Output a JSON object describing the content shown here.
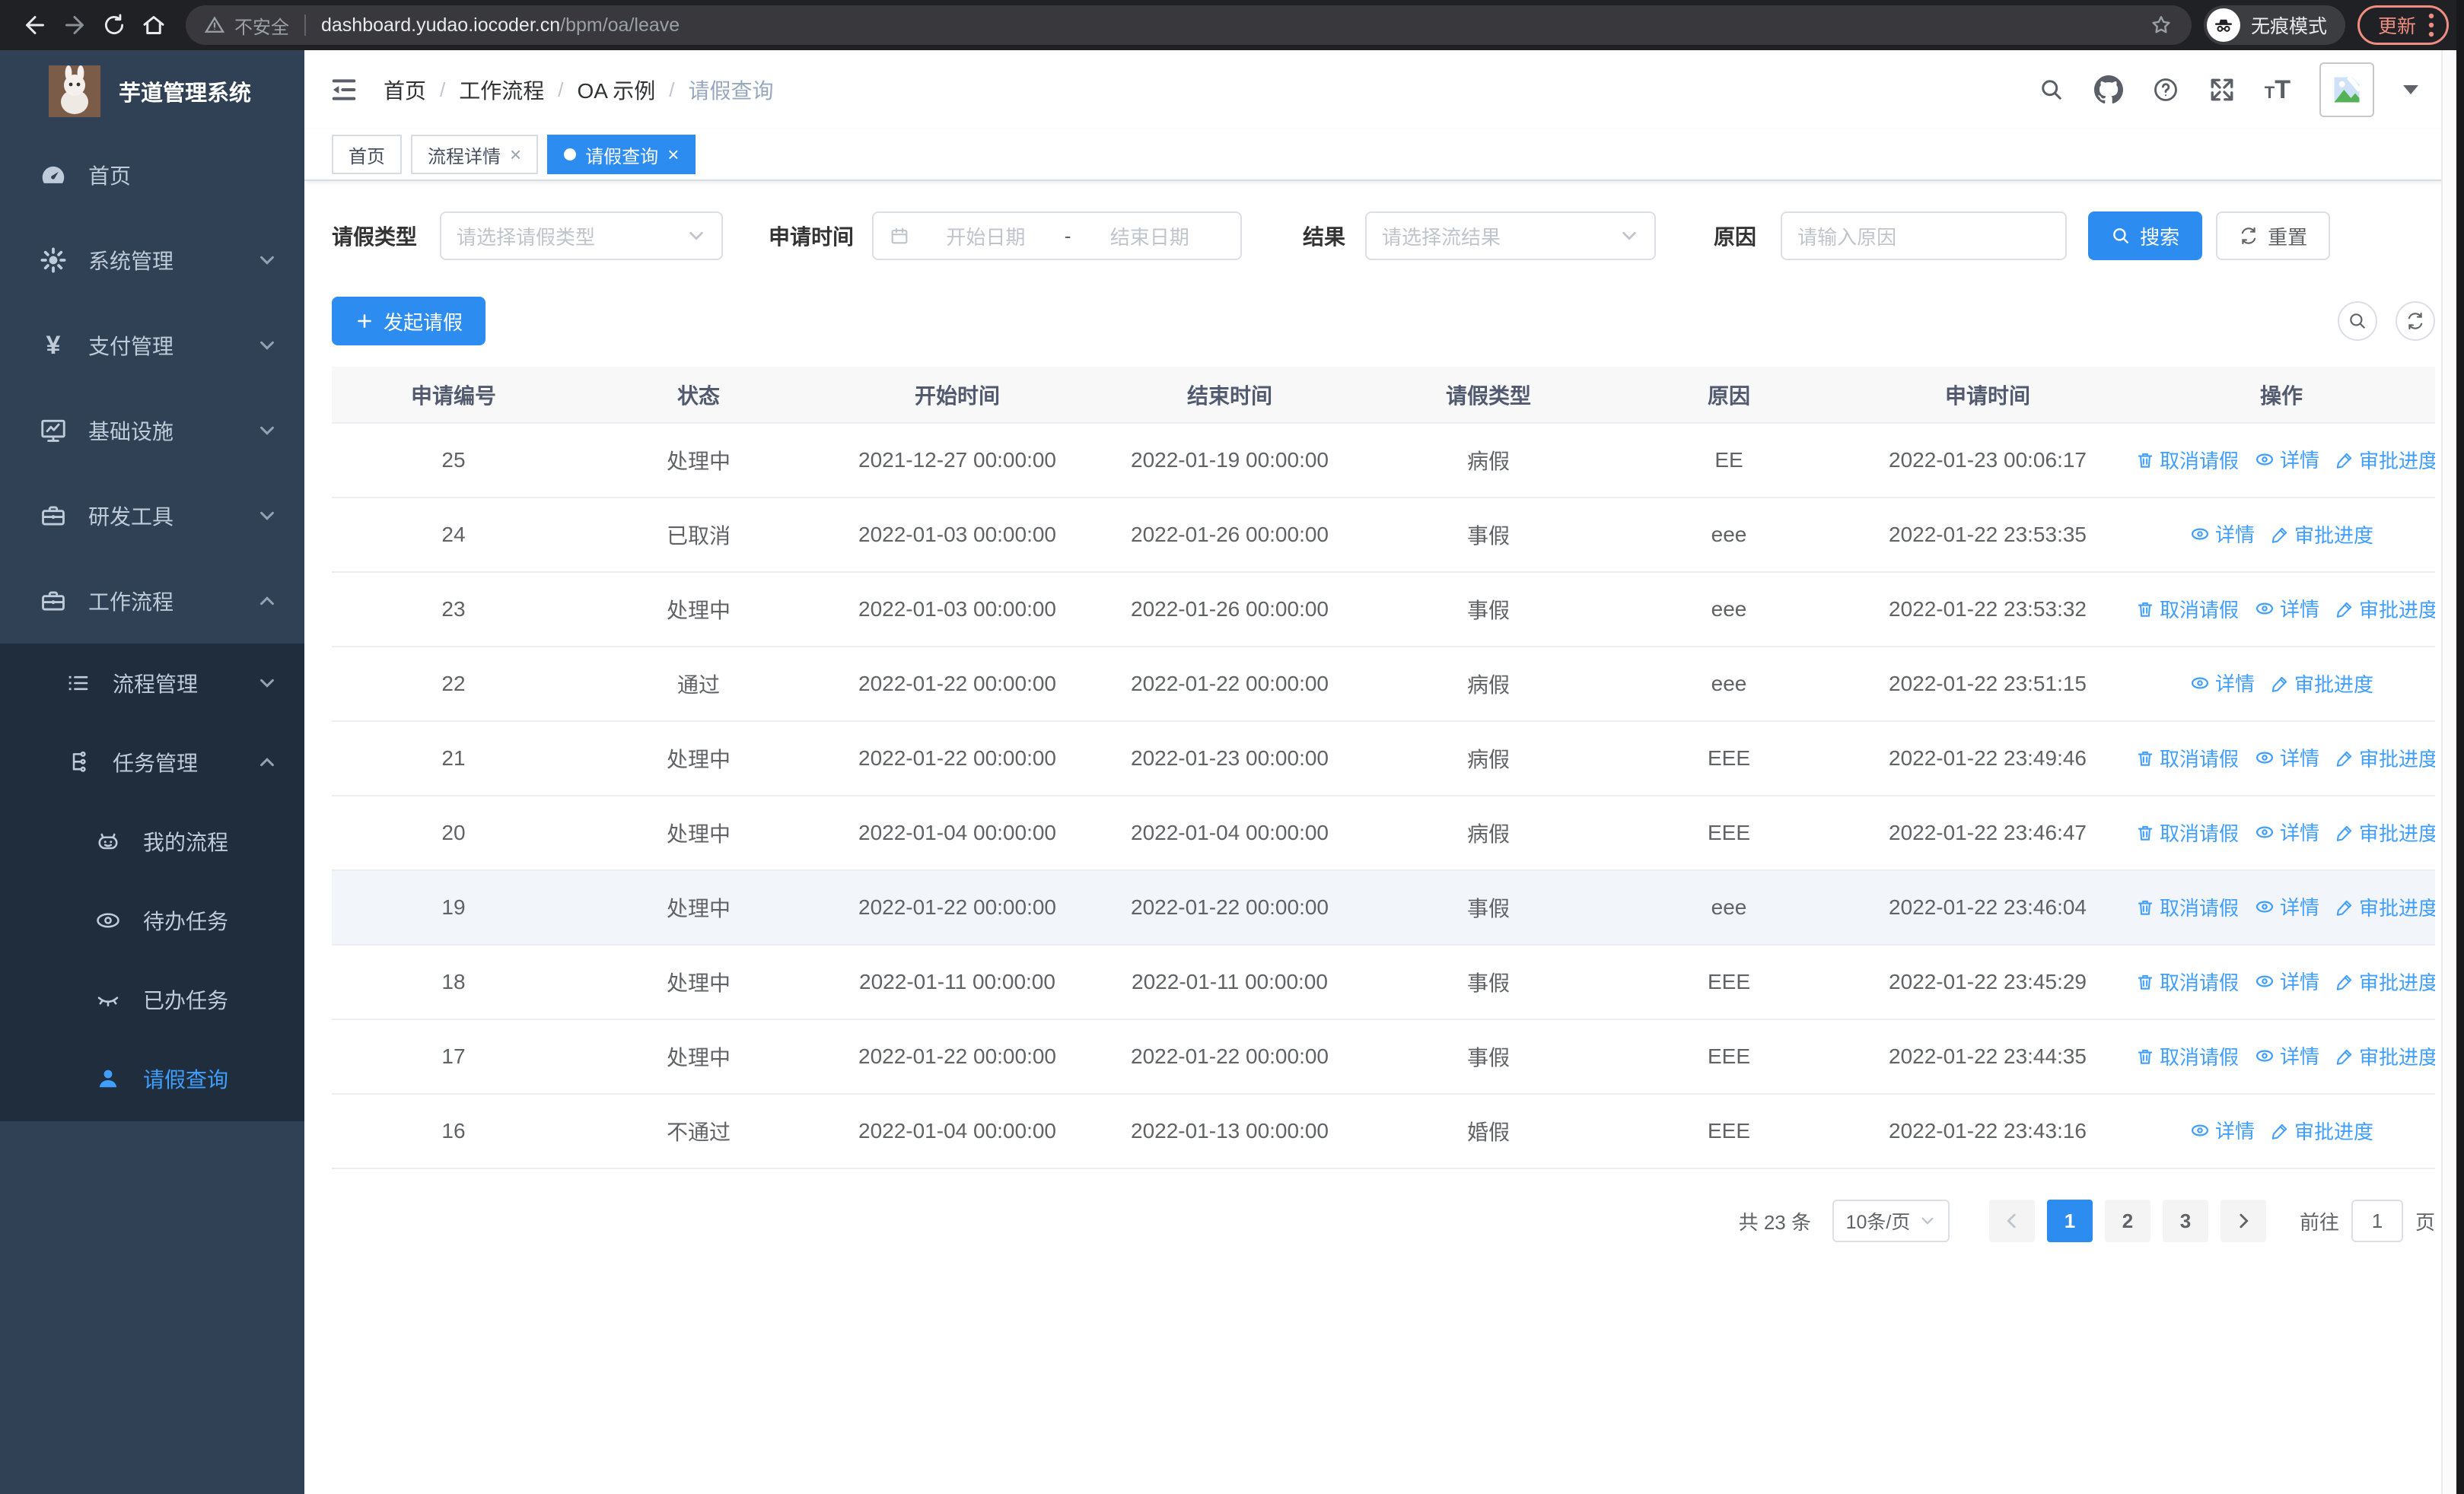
{
  "browser": {
    "security_label": "不安全",
    "url_host": "dashboard.yudao.iocoder.cn",
    "url_path": "/bpm/oa/leave",
    "incognito_label": "无痕模式",
    "update_label": "更新"
  },
  "sidebar": {
    "logo_title": "芋道管理系统",
    "menu": [
      {
        "label": "首页",
        "icon": "dashboard-icon"
      },
      {
        "label": "系统管理",
        "icon": "gear-icon"
      },
      {
        "label": "支付管理",
        "icon": "yen-icon"
      },
      {
        "label": "基础设施",
        "icon": "monitor-icon"
      },
      {
        "label": "研发工具",
        "icon": "toolbox-icon"
      },
      {
        "label": "工作流程",
        "icon": "toolbox-icon"
      }
    ],
    "submenu": [
      {
        "label": "流程管理",
        "icon": "list-icon"
      },
      {
        "label": "任务管理",
        "icon": "flow-tree-icon"
      },
      {
        "label": "我的流程",
        "icon": "robot-icon"
      },
      {
        "label": "待办任务",
        "icon": "eye-icon"
      },
      {
        "label": "已办任务",
        "icon": "eye-closed-icon"
      },
      {
        "label": "请假查询",
        "icon": "user-icon"
      }
    ]
  },
  "header": {
    "breadcrumb": [
      "首页",
      "工作流程",
      "OA 示例",
      "请假查询"
    ]
  },
  "tabs": [
    {
      "label": "首页",
      "closable": false,
      "active": false
    },
    {
      "label": "流程详情",
      "closable": true,
      "active": false
    },
    {
      "label": "请假查询",
      "closable": true,
      "active": true
    }
  ],
  "filters": {
    "leave_type_label": "请假类型",
    "leave_type_placeholder": "请选择请假类型",
    "apply_time_label": "申请时间",
    "date_start_placeholder": "开始日期",
    "date_separator": "-",
    "date_end_placeholder": "结束日期",
    "result_label": "结果",
    "result_placeholder": "请选择流结果",
    "reason_label": "原因",
    "reason_placeholder": "请输入原因",
    "search_label": "搜索",
    "reset_label": "重置"
  },
  "toolbar": {
    "create_label": "发起请假"
  },
  "table": {
    "columns": [
      "申请编号",
      "状态",
      "开始时间",
      "结束时间",
      "请假类型",
      "原因",
      "申请时间",
      "操作"
    ],
    "action_labels": {
      "cancel": "取消请假",
      "detail": "详情",
      "progress": "审批进度"
    },
    "rows": [
      {
        "id": "25",
        "status": "处理中",
        "start": "2021-12-27 00:00:00",
        "end": "2022-01-19 00:00:00",
        "type": "病假",
        "reason": "EE",
        "applied": "2022-01-23 00:06:17",
        "actions": [
          "cancel",
          "detail",
          "progress"
        ],
        "highlight": false
      },
      {
        "id": "24",
        "status": "已取消",
        "start": "2022-01-03 00:00:00",
        "end": "2022-01-26 00:00:00",
        "type": "事假",
        "reason": "eee",
        "applied": "2022-01-22 23:53:35",
        "actions": [
          "detail",
          "progress"
        ],
        "highlight": false
      },
      {
        "id": "23",
        "status": "处理中",
        "start": "2022-01-03 00:00:00",
        "end": "2022-01-26 00:00:00",
        "type": "事假",
        "reason": "eee",
        "applied": "2022-01-22 23:53:32",
        "actions": [
          "cancel",
          "detail",
          "progress"
        ],
        "highlight": false
      },
      {
        "id": "22",
        "status": "通过",
        "start": "2022-01-22 00:00:00",
        "end": "2022-01-22 00:00:00",
        "type": "病假",
        "reason": "eee",
        "applied": "2022-01-22 23:51:15",
        "actions": [
          "detail",
          "progress"
        ],
        "highlight": false
      },
      {
        "id": "21",
        "status": "处理中",
        "start": "2022-01-22 00:00:00",
        "end": "2022-01-23 00:00:00",
        "type": "病假",
        "reason": "EEE",
        "applied": "2022-01-22 23:49:46",
        "actions": [
          "cancel",
          "detail",
          "progress"
        ],
        "highlight": false
      },
      {
        "id": "20",
        "status": "处理中",
        "start": "2022-01-04 00:00:00",
        "end": "2022-01-04 00:00:00",
        "type": "病假",
        "reason": "EEE",
        "applied": "2022-01-22 23:46:47",
        "actions": [
          "cancel",
          "detail",
          "progress"
        ],
        "highlight": false
      },
      {
        "id": "19",
        "status": "处理中",
        "start": "2022-01-22 00:00:00",
        "end": "2022-01-22 00:00:00",
        "type": "事假",
        "reason": "eee",
        "applied": "2022-01-22 23:46:04",
        "actions": [
          "cancel",
          "detail",
          "progress"
        ],
        "highlight": true
      },
      {
        "id": "18",
        "status": "处理中",
        "start": "2022-01-11 00:00:00",
        "end": "2022-01-11 00:00:00",
        "type": "事假",
        "reason": "EEE",
        "applied": "2022-01-22 23:45:29",
        "actions": [
          "cancel",
          "detail",
          "progress"
        ],
        "highlight": false
      },
      {
        "id": "17",
        "status": "处理中",
        "start": "2022-01-22 00:00:00",
        "end": "2022-01-22 00:00:00",
        "type": "事假",
        "reason": "EEE",
        "applied": "2022-01-22 23:44:35",
        "actions": [
          "cancel",
          "detail",
          "progress"
        ],
        "highlight": false
      },
      {
        "id": "16",
        "status": "不通过",
        "start": "2022-01-04 00:00:00",
        "end": "2022-01-13 00:00:00",
        "type": "婚假",
        "reason": "EEE",
        "applied": "2022-01-22 23:43:16",
        "actions": [
          "detail",
          "progress"
        ],
        "highlight": false
      }
    ]
  },
  "pagination": {
    "total_label": "共 23 条",
    "page_size_label": "10条/页",
    "pages": [
      "1",
      "2",
      "3"
    ],
    "active_page": "1",
    "goto_label": "前往",
    "goto_value": "1",
    "page_suffix": "页"
  },
  "colors": {
    "accent": "#2d8cf0",
    "link": "#409eff",
    "sidebar_bg": "#304156",
    "submenu_bg": "#1f2d3d",
    "sidebar_text": "#bfcbd9",
    "table_header_bg": "#f8f8f9",
    "row_highlight": "#f2f5fa",
    "chrome_bg": "#202124",
    "update_red": "#ef8d80"
  }
}
